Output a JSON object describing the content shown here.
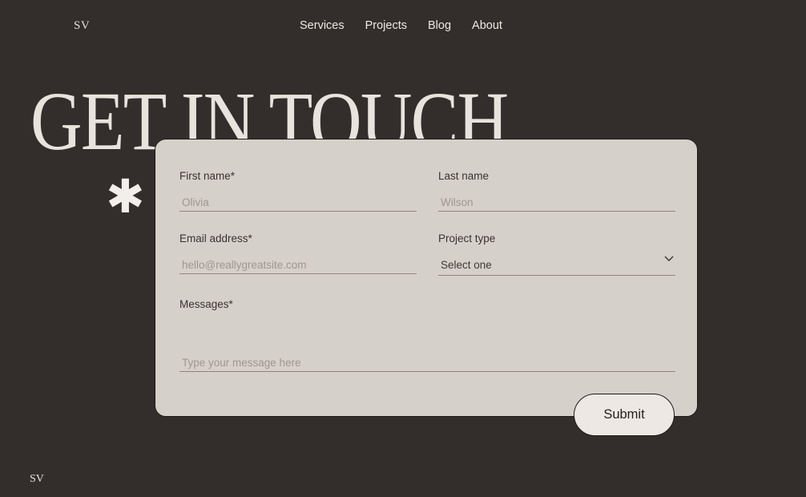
{
  "header": {
    "logo": "SV",
    "nav": [
      "Services",
      "Projects",
      "Blog",
      "About"
    ]
  },
  "hero": {
    "title": "GET IN TOUCH",
    "asterisk": "✱"
  },
  "form": {
    "first_name": {
      "label": "First name*",
      "placeholder": "Olivia"
    },
    "last_name": {
      "label": "Last name",
      "placeholder": "Wilson"
    },
    "email": {
      "label": "Email address*",
      "placeholder": "hello@reallygreatsite.com"
    },
    "project_type": {
      "label": "Project type",
      "selected": "Select one"
    },
    "message": {
      "label": "Messages*",
      "placeholder": "Type your message here"
    },
    "submit_label": "Submit"
  },
  "footer": {
    "logo": "SV"
  },
  "colors": {
    "background": "#332e2c",
    "card": "#d6d0ca",
    "button": "#ede8e3"
  }
}
